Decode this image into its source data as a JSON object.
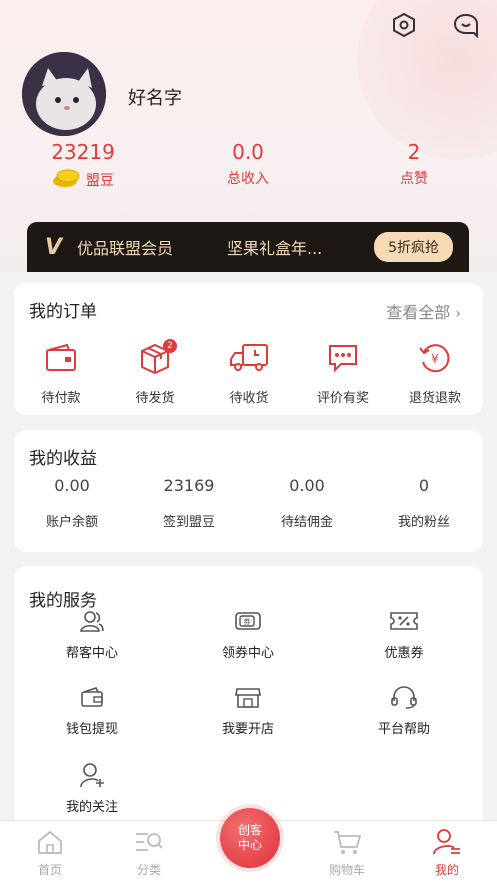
{
  "profile": {
    "username": "好名字"
  },
  "stats": [
    {
      "value": "23219",
      "label": "盟豆"
    },
    {
      "value": "0.0",
      "label": "总收入"
    },
    {
      "value": "2",
      "label": "点赞"
    }
  ],
  "vip": {
    "logo": "V",
    "title": "优品联盟会员",
    "item": "坚果礼盒年...",
    "button": "5折疯抢"
  },
  "orders": {
    "title": "我的订单",
    "see_all": "查看全部",
    "items": [
      {
        "label": "待付款",
        "icon": "wallet-icon"
      },
      {
        "label": "待发货",
        "icon": "box-icon",
        "badge": "2"
      },
      {
        "label": "待收货",
        "icon": "truck-icon"
      },
      {
        "label": "评价有奖",
        "icon": "comment-icon"
      },
      {
        "label": "退货退款",
        "icon": "refund-icon"
      }
    ]
  },
  "earnings": {
    "title": "我的收益",
    "items": [
      {
        "value": "0.00",
        "label": "账户余额"
      },
      {
        "value": "23169",
        "label": "签到盟豆"
      },
      {
        "value": "0.00",
        "label": "待结佣金"
      },
      {
        "value": "0",
        "label": "我的粉丝"
      }
    ]
  },
  "services": {
    "title": "我的服务",
    "items": [
      {
        "label": "帮客中心",
        "icon": "users-icon"
      },
      {
        "label": "领券中心",
        "icon": "ticket-icon"
      },
      {
        "label": "优惠券",
        "icon": "coupon-icon"
      },
      {
        "label": "钱包提现",
        "icon": "wallet-withdraw-icon"
      },
      {
        "label": "我要开店",
        "icon": "store-icon"
      },
      {
        "label": "平台帮助",
        "icon": "headset-icon"
      },
      {
        "label": "我的关注",
        "icon": "follow-icon"
      }
    ]
  },
  "tabbar": {
    "items": [
      {
        "label": "首页",
        "icon": "home-icon"
      },
      {
        "label": "分类",
        "icon": "category-icon"
      },
      {
        "label": "购物车",
        "icon": "cart-icon"
      },
      {
        "label": "我的",
        "icon": "profile-icon"
      }
    ],
    "center": {
      "line1": "创客",
      "line2": "中心"
    }
  },
  "colors": {
    "accent": "#e03a3a",
    "vip_bg": "#1e1815",
    "vip_gold": "#f7dbb7"
  }
}
